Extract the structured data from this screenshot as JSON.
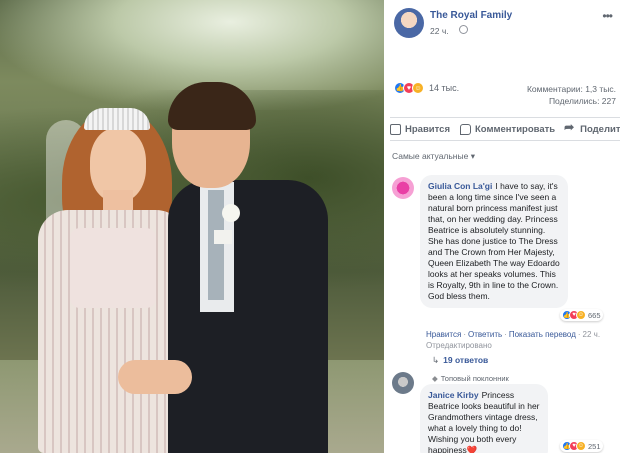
{
  "post": {
    "page_name": "The Royal Family",
    "time": "22 ч.",
    "icons": {
      "privacy": "globe-icon",
      "more": "more-dots-icon"
    }
  },
  "stats": {
    "reactions_count": "14 тыс.",
    "comments": "Комментарии: 1,3 тыс.",
    "shares": "Поделились: 227"
  },
  "actions": {
    "like": "Нравится",
    "comment": "Комментировать",
    "share": "Поделиться"
  },
  "sort_label": "Самые актуальные ▾",
  "comments": [
    {
      "author": "Giulia Con La'gi",
      "text": "I have to say, it's been a long time since I've seen a natural born princess manifest just that, on her wedding day. Princess Beatrice is absolutely stunning. She has done justice to The Dress and The Crown from Her Majesty, Queen Elizabeth The way Edoardo looks at her speaks volumes. This is Royalty, 9th in line to the Crown. God bless them.",
      "reactions": "665",
      "like": "Нравится",
      "reply": "Ответить",
      "translate": "Показать перевод",
      "time": "22 ч.",
      "edited": "Отредактировано",
      "replies": "19 ответов"
    },
    {
      "badge": "Топовый поклонник",
      "author": "Janice Kirby",
      "text": "Princess Beatrice looks beautiful in her Grandmothers vintage dress, what a lovely thing to do! Wishing you both every happiness❤️",
      "reactions": "251"
    }
  ],
  "colors": {
    "link": "#385898",
    "like": "#2078f4",
    "love": "#f33e58",
    "care": "#f7b125",
    "bubble": "#f2f3f5"
  }
}
